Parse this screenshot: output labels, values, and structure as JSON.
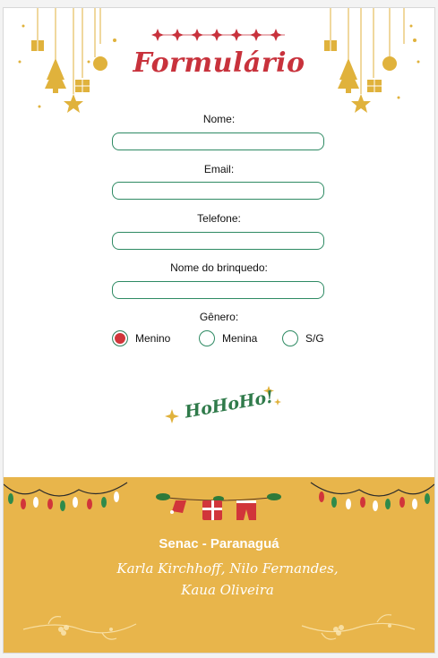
{
  "form": {
    "title": "Formulário",
    "fields": [
      {
        "label": "Nome:",
        "value": ""
      },
      {
        "label": "Email:",
        "value": ""
      },
      {
        "label": "Telefone:",
        "value": ""
      },
      {
        "label": "Nome  do brinquedo:",
        "value": ""
      }
    ],
    "gender": {
      "label": "Gênero:",
      "options": [
        "Menino",
        "Menina",
        "S/G"
      ],
      "selected": "Menino"
    }
  },
  "decoration": {
    "hohoho_text": "HoHoHo!"
  },
  "footer": {
    "title": "Senac - Paranaguá",
    "authors": "Karla Kirchhoff, Nilo Fernandes, Kaua Oliveira"
  },
  "colors": {
    "title_red": "#c8323c",
    "input_border_green": "#2e8a63",
    "gold": "#e0b23c",
    "footer_bg": "#e8b54b",
    "radio_selected": "#d1353a"
  }
}
